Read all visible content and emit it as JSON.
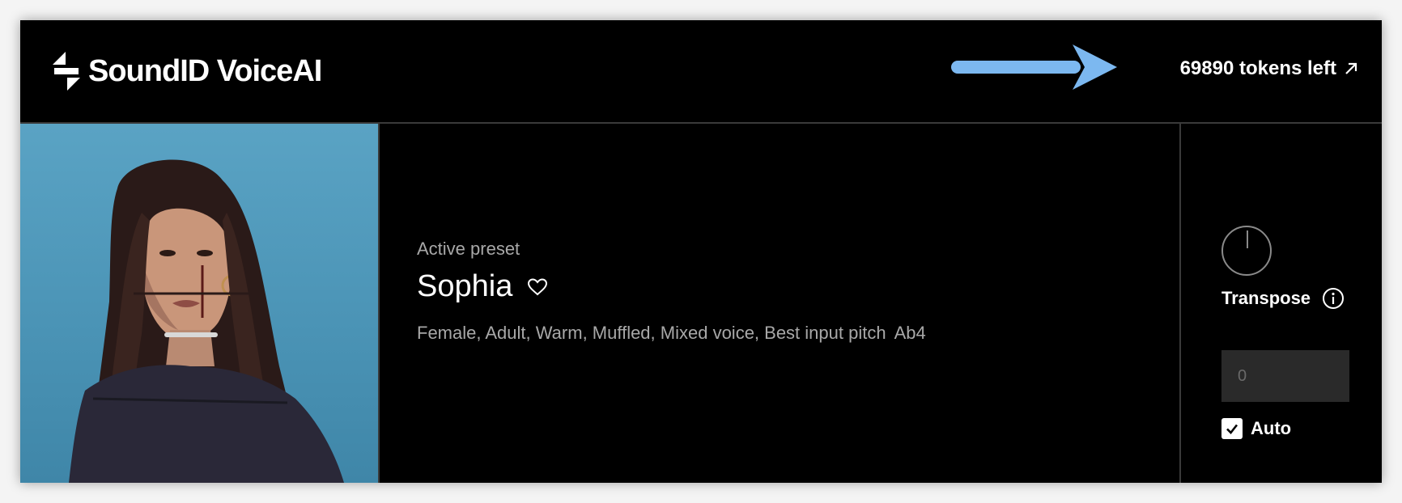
{
  "app": {
    "brand": "SoundID VoiceAI",
    "logo_icon": "soundid-logo-icon"
  },
  "header": {
    "tokens_label": "69890 tokens left",
    "tokens_icon": "external-link-arrow-icon",
    "annotation_arrow_color": "#7cb8f0"
  },
  "preset": {
    "section_label": "Active preset",
    "name": "Sophia",
    "favorite_icon": "heart-icon",
    "tags": "Female, Adult, Warm, Muffled, Mixed voice, Best input pitch",
    "best_pitch": "Ab4"
  },
  "controls": {
    "transpose_label": "Transpose",
    "transpose_info_icon": "info-icon",
    "transpose_value": "0",
    "auto_label": "Auto",
    "auto_checked": true
  },
  "colors": {
    "background": "#000000",
    "photo_background": "#4b94b6",
    "muted_text": "#a8a8a8",
    "input_background": "#2a2a2a"
  }
}
